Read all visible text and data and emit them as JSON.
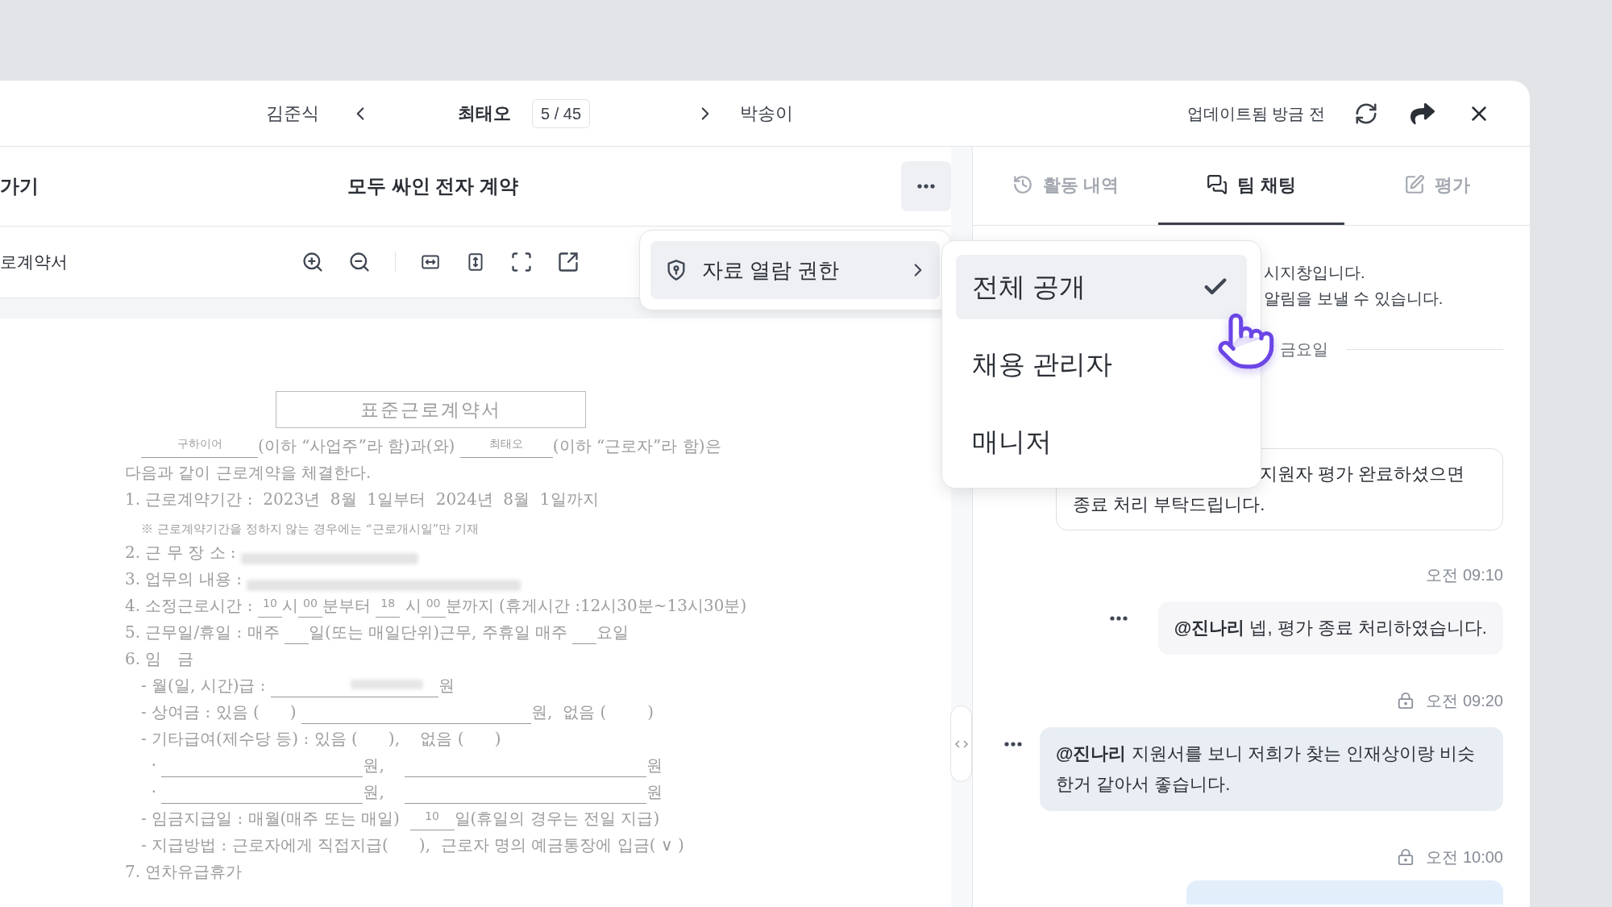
{
  "nav": {
    "prev_name": "김준식",
    "current_name": "최태오",
    "position": "5 / 45",
    "next_name": "박송이",
    "updated": "업데이트됨 방금 전"
  },
  "document": {
    "back_label": "가기",
    "title": "모두 싸인 전자 계약",
    "file_name": "로계약서",
    "page_title": "표준근로계약서",
    "lines": [
      {
        "kind": "para",
        "parts": [
          {
            "kind": "blank_lg",
            "text": "구하이어"
          },
          {
            "kind": "text",
            "text": "(이하 “사업주”라 함)과(와) "
          },
          {
            "kind": "blank_md",
            "text": "최태오"
          },
          {
            "kind": "text",
            "text": "(이하 “근로자”라 함)은"
          }
        ]
      },
      {
        "kind": "item",
        "parts": [
          {
            "kind": "text",
            "text": "다음과 같이 근로계약을 체결한다."
          }
        ]
      },
      {
        "kind": "item",
        "parts": [
          {
            "kind": "text",
            "text": "1. 근로계약기간 :  2023년  8월  1일부터  2024년  8월  1일까지"
          }
        ]
      },
      {
        "kind": "note",
        "parts": [
          {
            "kind": "text",
            "text": "※ 근로계약기간을 정하지 않는 경우에는 “근로개시일”만 기재"
          }
        ]
      },
      {
        "kind": "item",
        "parts": [
          {
            "kind": "text",
            "text": "2. 근 무 장 소 : "
          },
          {
            "kind": "redacted_md"
          }
        ]
      },
      {
        "kind": "item",
        "parts": [
          {
            "kind": "text",
            "text": "3. 업무의 내용 : "
          },
          {
            "kind": "redacted_lg"
          }
        ]
      },
      {
        "kind": "item",
        "parts": [
          {
            "kind": "text",
            "text": "4. 소정근로시간 : "
          },
          {
            "kind": "blank_xs",
            "text": "10"
          },
          {
            "kind": "text",
            "text": "시"
          },
          {
            "kind": "blank_xs",
            "text": "00"
          },
          {
            "kind": "text",
            "text": "분부터 "
          },
          {
            "kind": "blank_xs",
            "text": "18"
          },
          {
            "kind": "text",
            "text": " 시"
          },
          {
            "kind": "blank_xs",
            "text": "00"
          },
          {
            "kind": "text",
            "text": "분까지 (휴게시간 :12시30분~13시30분)"
          }
        ]
      },
      {
        "kind": "item",
        "parts": [
          {
            "kind": "text",
            "text": "5. 근무일/휴일 : 매주 "
          },
          {
            "kind": "blank_xs"
          },
          {
            "kind": "text",
            "text": "일(또는 매일단위)근무, 주휴일 매주 "
          },
          {
            "kind": "blank_xs"
          },
          {
            "kind": "text",
            "text": "요일"
          }
        ]
      },
      {
        "kind": "item",
        "parts": [
          {
            "kind": "text",
            "text": "6. 임   금"
          }
        ]
      },
      {
        "kind": "sub",
        "parts": [
          {
            "kind": "text",
            "text": "- 월(일, 시간)급 : "
          },
          {
            "kind": "blank_redacted"
          },
          {
            "kind": "text",
            "text": "원"
          }
        ]
      },
      {
        "kind": "sub",
        "parts": [
          {
            "kind": "text",
            "text": "- 상여금 : 있음 (      ) "
          },
          {
            "kind": "blank_2xl"
          },
          {
            "kind": "text",
            "text": "원,  없음 (        )"
          }
        ]
      },
      {
        "kind": "sub",
        "parts": [
          {
            "kind": "text",
            "text": "- 기타급여(제수당 등) : 있음 (      ),    없음 (      )"
          }
        ]
      },
      {
        "kind": "sub",
        "parts": [
          {
            "kind": "text",
            "text": "  · "
          },
          {
            "kind": "blank_3xl"
          },
          {
            "kind": "text",
            "text": "원,    "
          },
          {
            "kind": "blank_4xl"
          },
          {
            "kind": "text",
            "text": "원"
          }
        ]
      },
      {
        "kind": "sub",
        "parts": [
          {
            "kind": "text",
            "text": "  · "
          },
          {
            "kind": "blank_3xl"
          },
          {
            "kind": "text",
            "text": "원,    "
          },
          {
            "kind": "blank_4xl"
          },
          {
            "kind": "text",
            "text": "원"
          }
        ]
      },
      {
        "kind": "sub",
        "parts": [
          {
            "kind": "text",
            "text": "- 임금지급일 : 매월(매주 또는 매일)  "
          },
          {
            "kind": "blank_sm",
            "text": "10"
          },
          {
            "kind": "text",
            "text": "일(휴일의 경우는 전일 지급)"
          }
        ]
      },
      {
        "kind": "sub",
        "parts": [
          {
            "kind": "text",
            "text": "- 지급방법 : 근로자에게 직접지급(      ),  근로자 명의 예금통장에 입금( ∨ )"
          }
        ]
      },
      {
        "kind": "item",
        "parts": [
          {
            "kind": "text",
            "text": "7. 연차유급휴가"
          }
        ]
      }
    ]
  },
  "menu": {
    "items": [
      {
        "label": "자료 열람 권한"
      }
    ],
    "submenu": [
      {
        "label": "전체 공개",
        "selected": true
      },
      {
        "label": "채용 관리자",
        "selected": false
      },
      {
        "label": "매니저",
        "selected": false
      }
    ]
  },
  "tabs": [
    {
      "kind": "history",
      "label": "활동 내역",
      "selected": false
    },
    {
      "kind": "chat",
      "label": "팀 채팅",
      "selected": true
    },
    {
      "kind": "review",
      "label": "평가",
      "selected": false
    }
  ],
  "chat": {
    "notice": [
      "시지창입니다.",
      "알림을 보낼 수 있습니다."
    ],
    "date": "금요일",
    "messages": [
      {
        "kind": "bordered",
        "lines": [
          "지원자 평가 완료하셨으면",
          "종료 처리 부탁드립니다."
        ]
      },
      {
        "kind": "time",
        "text": "오전 09:10",
        "locked": false
      },
      {
        "kind": "plain",
        "text": "**@진나리** 넵, 평가 종료 처리하였습니다."
      },
      {
        "kind": "time",
        "text": "오전 09:20",
        "locked": true
      },
      {
        "kind": "highlight",
        "text": "**@진나리** 지원서를 보니 저희가 찾는 인재상이랑 비슷한거 같아서 좋습니다."
      },
      {
        "kind": "time",
        "text": "오전 10:00",
        "locked": true
      },
      {
        "kind": "partial"
      }
    ]
  }
}
